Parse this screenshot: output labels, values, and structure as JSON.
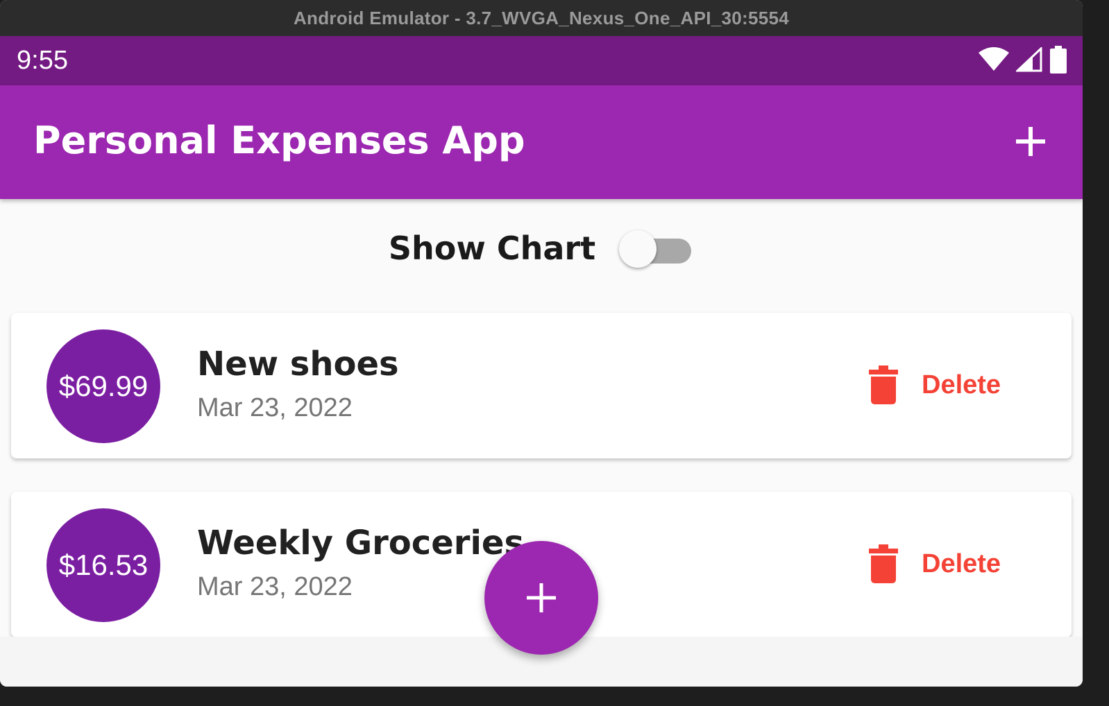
{
  "window": {
    "title": "Android Emulator - 3.7_WVGA_Nexus_One_API_30:5554"
  },
  "status_bar": {
    "time": "9:55",
    "icons": [
      "wifi-icon",
      "signal-icon",
      "battery-icon"
    ]
  },
  "app_bar": {
    "title": "Personal Expenses App",
    "action_icon": "add-icon"
  },
  "chart_toggle": {
    "label": "Show Chart",
    "value": false
  },
  "transactions": [
    {
      "amount": "$69.99",
      "title": "New shoes",
      "date": "Mar 23, 2022",
      "delete_label": "Delete",
      "delete_icon": "trash-icon"
    },
    {
      "amount": "$16.53",
      "title": "Weekly Groceries",
      "date": "Mar 23, 2022",
      "delete_label": "Delete",
      "delete_icon": "trash-icon"
    }
  ],
  "fab": {
    "icon": "add-icon"
  },
  "colors": {
    "primary": "#9c27b0",
    "primary_dark": "#741b83",
    "amount_circle": "#7b1fa2",
    "delete": "#f44336"
  }
}
